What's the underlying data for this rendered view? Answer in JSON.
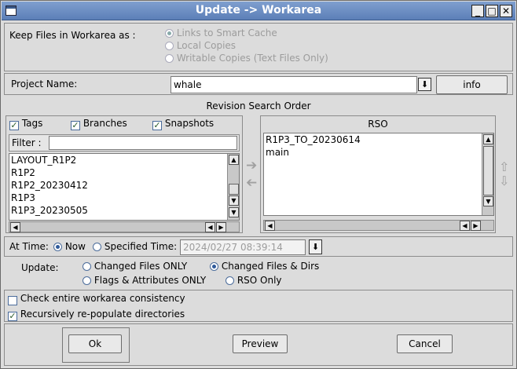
{
  "title": "Update -> Workarea",
  "keep_files": {
    "label": "Keep Files in Workarea as :",
    "options": [
      "Links to Smart Cache",
      "Local Copies",
      "Writable Copies (Text Files Only)"
    ]
  },
  "project": {
    "label": "Project Name:",
    "value": "whale",
    "info_label": "info"
  },
  "rso_section": {
    "title": "Revision Search Order",
    "filters": [
      "Tags",
      "Branches",
      "Snapshots"
    ],
    "filter_label": "Filter :",
    "filter_value": "",
    "left_items": [
      "LAYOUT_R1P2",
      "R1P2",
      "R1P2_20230412",
      "R1P3",
      "R1P3_20230505"
    ],
    "rso_header": "RSO",
    "rso_items": [
      "R1P3_TO_20230614",
      "main"
    ]
  },
  "at_time": {
    "label": "At Time:",
    "now_label": "Now",
    "specified_label": "Specified Time:",
    "specified_value": "2024/02/27 08:39:14"
  },
  "update": {
    "label": "Update:",
    "options": [
      "Changed Files ONLY",
      "Changed Files & Dirs",
      "Flags & Attributes ONLY",
      "RSO Only"
    ]
  },
  "options": {
    "check_consistency": "Check entire workarea consistency",
    "repopulate": "Recursively re-populate directories"
  },
  "buttons": {
    "ok": "Ok",
    "preview": "Preview",
    "cancel": "Cancel"
  },
  "icons": {
    "window": "window-icon",
    "minimize": "minimize-icon",
    "maximize": "maximize-icon",
    "close": "close-icon",
    "dropdown": "dropdown-arrow-icon",
    "move_right": "arrow-right-icon",
    "move_left": "arrow-left-icon",
    "move_up": "arrow-up-icon",
    "move_down": "arrow-down-icon"
  }
}
